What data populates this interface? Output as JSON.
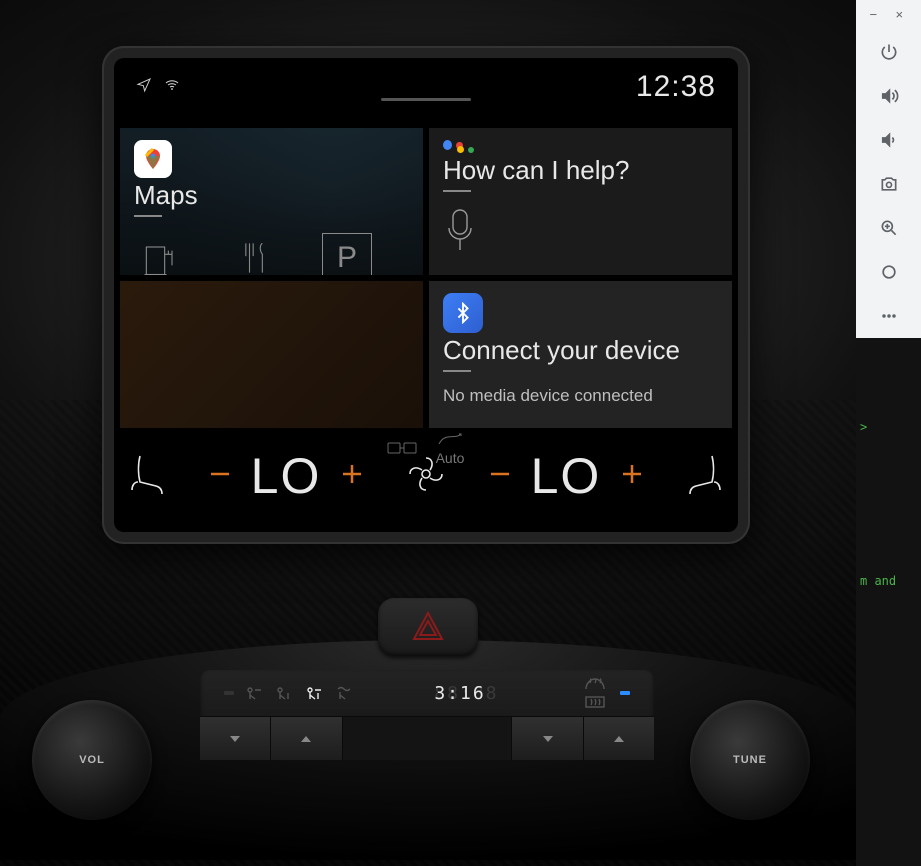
{
  "emu": {
    "btns": [
      "power",
      "volume-up",
      "volume-down",
      "camera",
      "zoom",
      "circle",
      "more"
    ]
  },
  "statusbar": {
    "clock": "12:38"
  },
  "cards": {
    "maps": {
      "title": "Maps",
      "poi_park": "P"
    },
    "assistant": {
      "title": "How can I help?"
    },
    "media": {
      "title": "Connect your device",
      "sub": "No media device connected"
    }
  },
  "climate": {
    "sync_mode": "Auto",
    "left_temp": "LO",
    "right_temp": "LO"
  },
  "dash": {
    "ac_time": "3:16",
    "ac_ghost": "88:88",
    "vol_label": "VOL",
    "tune_label": "TUNE"
  },
  "bg_terminal": {
    "l1": ">",
    "l2": "m and"
  }
}
